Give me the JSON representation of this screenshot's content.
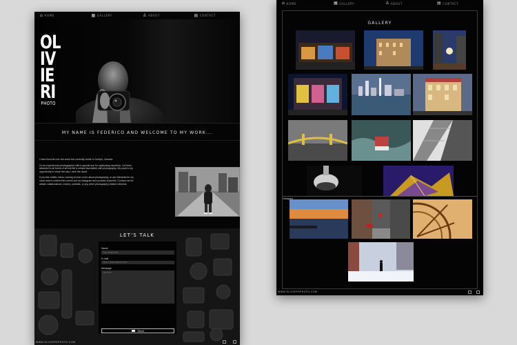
{
  "nav": [
    {
      "label": "Home",
      "icon": "home-icon"
    },
    {
      "label": "Gallery",
      "icon": "gallery-icon"
    },
    {
      "label": "About",
      "icon": "person-icon"
    },
    {
      "label": "Contact",
      "icon": "chat-icon"
    }
  ],
  "logo": {
    "lines": [
      "OL",
      "IV",
      "IE",
      "RI"
    ],
    "sub": "PHOTO"
  },
  "welcome": "My name is Federico and welcome to my work...",
  "about": {
    "paragraphs": [
      "I have lived all over the world but currently reside in Guelph, Canada.",
      "I'm an experienced photographer with a special eye for captivating moments. I've been attracted to all forms of art but felt a unique fascination with photography. My work is my opportunity to share the way I view the world.",
      "If you like artistic views, looking to learn more about photography, or are interested in my most recent content then check out my instagram and youtube channels. Contact me for artistic collaborations, events, portraits, or any other photography related interests."
    ]
  },
  "contact": {
    "title": "Let's Talk",
    "name_label": "Name",
    "name_placeholder": "Your name here",
    "email_label": "E-mail",
    "email_placeholder": "Your e-mail address here",
    "message_label": "Message",
    "message_placeholder": "Your text",
    "send_label": "Send"
  },
  "footer": {
    "domain": "www.oliviersphoto.com"
  },
  "gallery": {
    "title": "Gallery",
    "side_label": "Instagram"
  },
  "colors": {
    "background": "#050505",
    "accent": "#ffffff",
    "frame": "#d9d9d9"
  }
}
